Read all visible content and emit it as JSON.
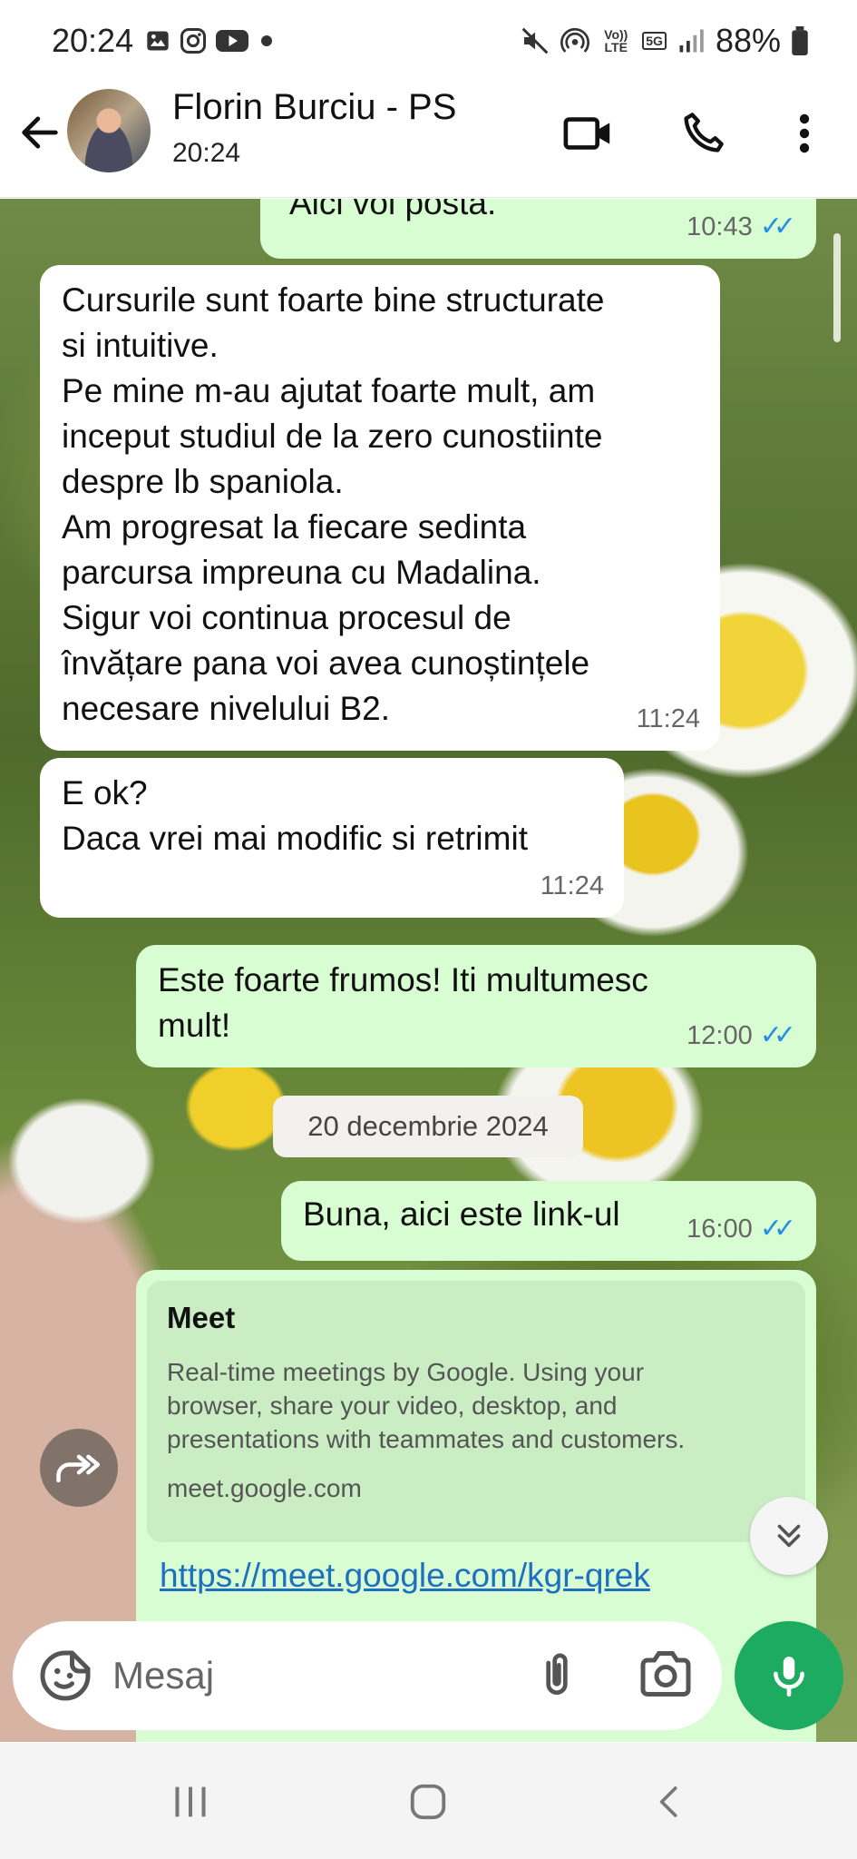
{
  "status_bar": {
    "time": "20:24",
    "battery": "88%",
    "volte": "Vo)) LTE",
    "network": "5G"
  },
  "header": {
    "contact_name": "Florin Burciu - PS",
    "last_seen": "20:24"
  },
  "messages": [
    {
      "direction": "out",
      "text": "Aici voi posta.",
      "time": "10:43",
      "read": true
    },
    {
      "direction": "in",
      "text": "Cursurile sunt foarte bine structurate\nsi intuitive.\nPe mine m-au ajutat foarte mult, am\ninceput studiul de la zero cunostiinte\ndespre lb spaniola.\nAm progresat la fiecare sedinta\nparcursa impreuna cu Madalina.\nSigur voi continua procesul de\nînvățare pana voi avea cunoștințele\nnecesare nivelului B2.",
      "time": "11:24"
    },
    {
      "direction": "in",
      "text": "E ok?\nDaca vrei mai modific si retrimit",
      "time": "11:24"
    },
    {
      "direction": "out",
      "text": "Este foarte frumos! Iti multumesc\nmult!",
      "time": "12:00",
      "read": true
    },
    {
      "direction": "out",
      "text": "Buna, aici este link-ul",
      "time": "16:00",
      "read": true
    }
  ],
  "date_separator": "20 decembrie 2024",
  "link_preview": {
    "title": "Meet",
    "description": "Real-time meetings by Google. Using your\nbrowser, share your video, desktop, and\npresentations with teammates and customers.",
    "domain": "meet.google.com",
    "url": "https://meet.google.com/kgr-qrek"
  },
  "input": {
    "placeholder": "Mesaj"
  },
  "icons": {
    "back": "arrow-left-icon",
    "video": "video-camera-icon",
    "call": "phone-icon",
    "menu": "more-vertical-icon",
    "forward": "forward-icon",
    "scroll_down": "chevron-double-down-icon",
    "emoji": "sticker-icon",
    "attach": "paperclip-icon",
    "camera": "camera-icon",
    "mic": "microphone-icon"
  },
  "colors": {
    "outgoing_bubble": "#d9fdd3",
    "incoming_bubble": "#ffffff",
    "read_ticks": "#2a8de4",
    "mic_button": "#1daa61",
    "link": "#1e6fbf"
  }
}
